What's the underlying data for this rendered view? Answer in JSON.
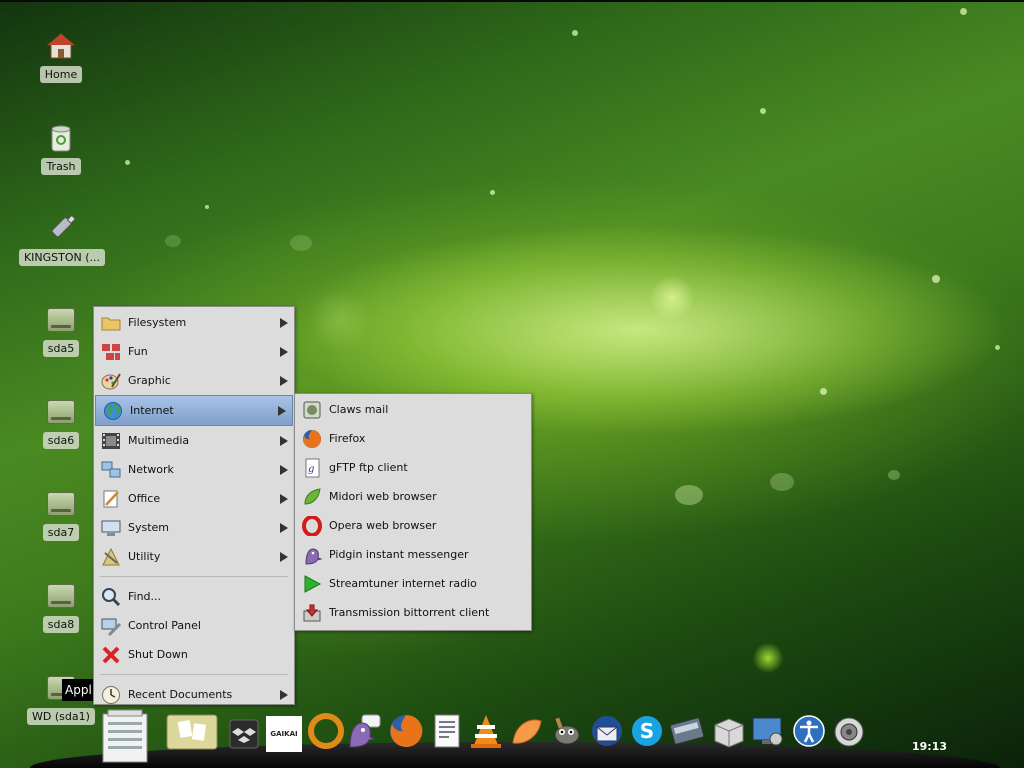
{
  "desktop": {
    "icons": [
      {
        "label": "Home",
        "icon": "home-icon"
      },
      {
        "label": "Trash",
        "icon": "trash-icon"
      },
      {
        "label": "KINGSTON (...",
        "icon": "usb-drive-icon"
      },
      {
        "label": "sda5",
        "icon": "drive-icon"
      },
      {
        "label": "sda6",
        "icon": "drive-icon"
      },
      {
        "label": "sda7",
        "icon": "drive-icon"
      },
      {
        "label": "sda8",
        "icon": "drive-icon"
      },
      {
        "label": "WD (sda1)",
        "icon": "drive-icon"
      }
    ],
    "tooltip": "Appl"
  },
  "main_menu": {
    "items": [
      {
        "label": "Filesystem",
        "icon": "folder-icon",
        "submenu": true
      },
      {
        "label": "Fun",
        "icon": "fun-icon",
        "submenu": true
      },
      {
        "label": "Graphic",
        "icon": "graphic-icon",
        "submenu": true
      },
      {
        "label": "Internet",
        "icon": "globe-icon",
        "submenu": true,
        "selected": true
      },
      {
        "label": "Multimedia",
        "icon": "multimedia-icon",
        "submenu": true
      },
      {
        "label": "Network",
        "icon": "network-icon",
        "submenu": true
      },
      {
        "label": "Office",
        "icon": "office-icon",
        "submenu": true
      },
      {
        "label": "System",
        "icon": "system-icon",
        "submenu": true
      },
      {
        "label": "Utility",
        "icon": "utility-icon",
        "submenu": true
      }
    ],
    "actions": [
      {
        "label": "Find...",
        "icon": "search-icon"
      },
      {
        "label": "Control Panel",
        "icon": "control-panel-icon"
      },
      {
        "label": "Shut Down",
        "icon": "shutdown-icon"
      }
    ],
    "recent": {
      "label": "Recent Documents",
      "icon": "clock-icon",
      "submenu": true
    }
  },
  "internet_submenu": {
    "items": [
      {
        "label": "Claws mail",
        "icon": "mail-icon"
      },
      {
        "label": "Firefox",
        "icon": "firefox-icon"
      },
      {
        "label": "gFTP ftp client",
        "icon": "ftp-icon"
      },
      {
        "label": "Midori web browser",
        "icon": "midori-icon"
      },
      {
        "label": "Opera web browser",
        "icon": "opera-icon"
      },
      {
        "label": "Pidgin instant messenger",
        "icon": "pidgin-icon"
      },
      {
        "label": "Streamtuner internet radio",
        "icon": "play-icon"
      },
      {
        "label": "Transmission bittorrent client",
        "icon": "transmission-icon"
      }
    ]
  },
  "taskbar": {
    "apps": [
      {
        "icon": "app-menu-icon"
      },
      {
        "icon": "notes-icon"
      },
      {
        "icon": "dropbox-icon"
      },
      {
        "icon": "gaikai-icon",
        "text": "GAIKAI"
      },
      {
        "icon": "ring-app-icon"
      },
      {
        "icon": "pidgin-icon"
      },
      {
        "icon": "firefox-icon"
      },
      {
        "icon": "document-icon"
      },
      {
        "icon": "vlc-icon"
      },
      {
        "icon": "orange-icon"
      },
      {
        "icon": "gimp-icon"
      },
      {
        "icon": "thunderbird-icon"
      },
      {
        "icon": "skype-icon"
      },
      {
        "icon": "scanner-icon"
      },
      {
        "icon": "package-icon"
      },
      {
        "icon": "desktop-settings-icon"
      },
      {
        "icon": "accessibility-icon"
      },
      {
        "icon": "speaker-icon"
      }
    ],
    "clock": "19:13"
  },
  "colors": {
    "menu_bg": "#dcdcdc",
    "selection": "#8fadd6"
  }
}
